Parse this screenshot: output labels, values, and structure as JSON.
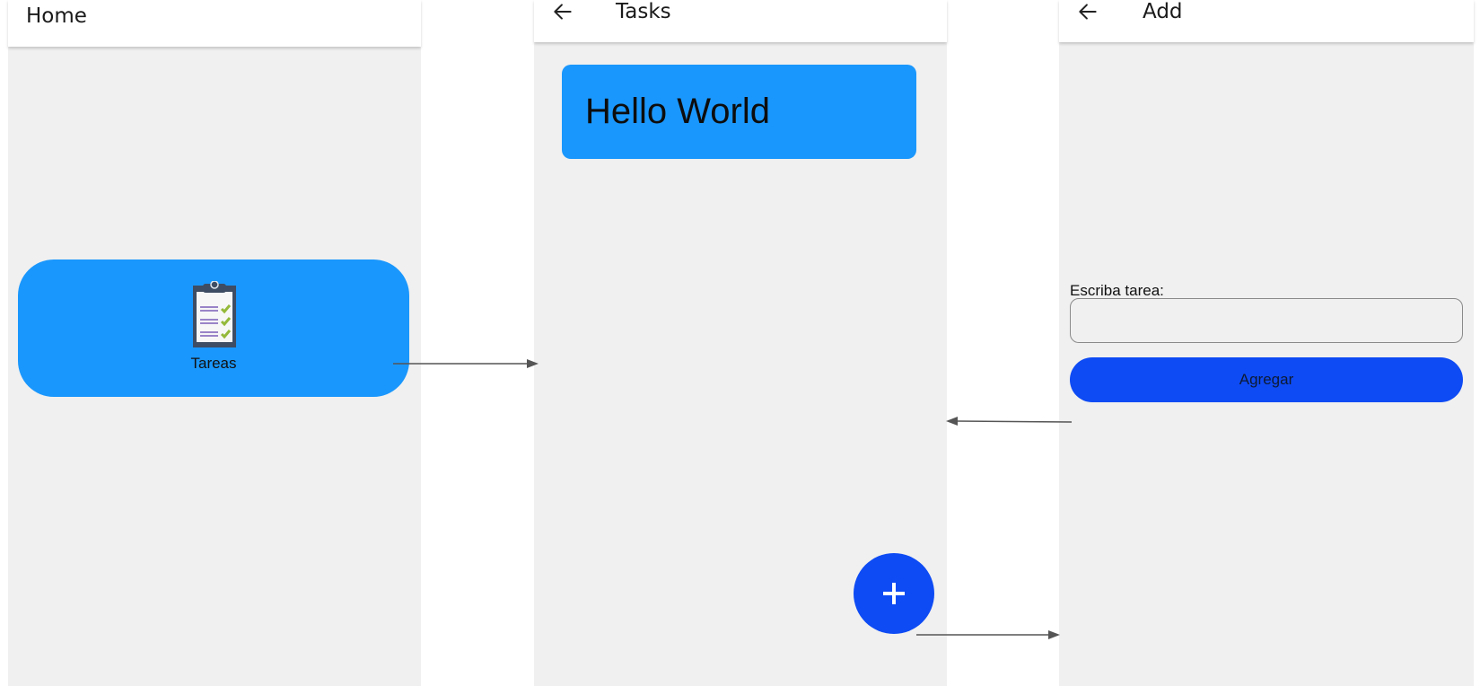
{
  "screens": {
    "home": {
      "title": "Home",
      "tile": {
        "icon": "clipboard-checklist-icon",
        "label": "Tareas"
      }
    },
    "tasks": {
      "title": "Tasks",
      "back_icon": "arrow-left-icon",
      "items": [
        {
          "text": "Hello World"
        }
      ],
      "fab": {
        "icon": "plus-icon",
        "label": "+"
      }
    },
    "add": {
      "title": "Add",
      "back_icon": "arrow-left-icon",
      "field_label": "Escriba tarea:",
      "input_value": "",
      "button_label": "Agregar"
    }
  },
  "colors": {
    "card_blue": "#1a97fc",
    "action_blue": "#0e4bf4",
    "screen_background": "#f0f0f0",
    "arrow": "#555555"
  },
  "flow_arrows": [
    {
      "from": "home-tile-tareas",
      "to": "tasks-screen"
    },
    {
      "from": "add-button",
      "to": "tasks-screen"
    },
    {
      "from": "add-task-fab",
      "to": "add-screen"
    }
  ]
}
